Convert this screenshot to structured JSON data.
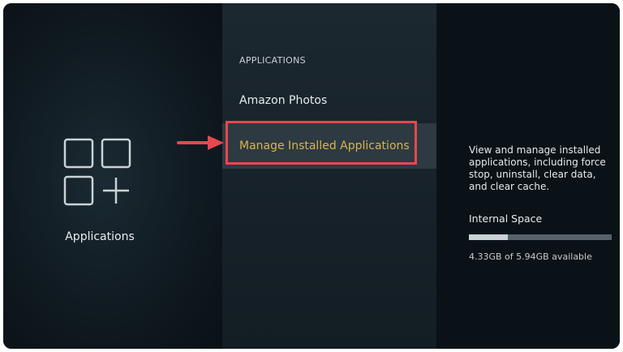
{
  "left_panel": {
    "icon": "apps-grid-icon",
    "label": "Applications"
  },
  "menu": {
    "header": "APPLICATIONS",
    "items": [
      {
        "label": "Amazon Photos"
      },
      {
        "label": "Manage Installed Applications",
        "selected": true
      }
    ]
  },
  "info_panel": {
    "description": "View and manage installed applications, including force stop, uninstall, clear data, and clear cache.",
    "storage_label": "Internal Space",
    "storage_used_fraction": 0.27,
    "storage_text": "4.33GB of 5.94GB available"
  },
  "annotation": {
    "icon": "arrow-right-icon",
    "highlight_color": "#e5484d"
  },
  "colors": {
    "selected_text": "#d9b44a",
    "background": "#0d151b"
  }
}
